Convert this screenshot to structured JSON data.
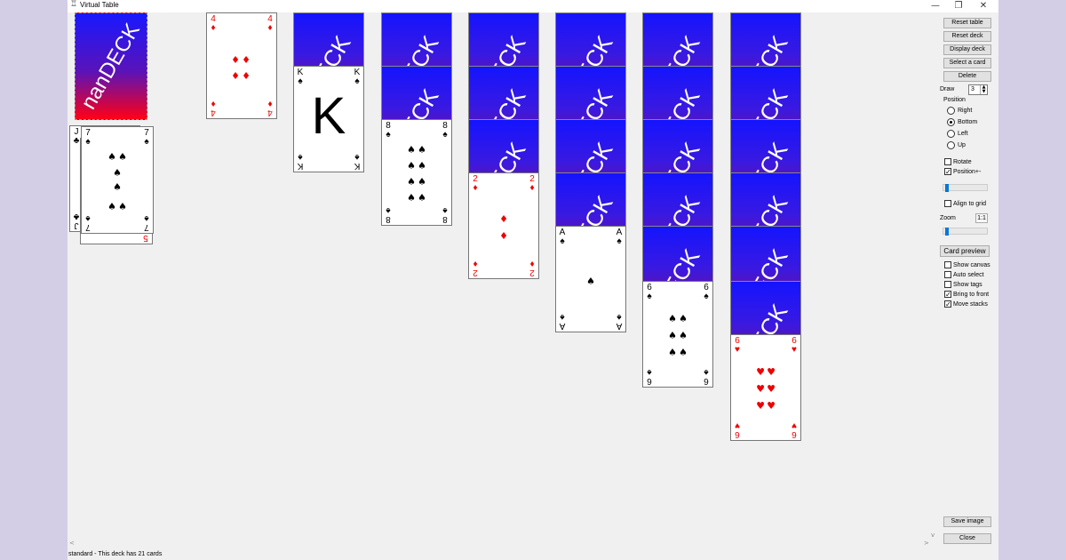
{
  "window": {
    "title": "Virtual Table",
    "minimize": "—",
    "restore": "❐",
    "close": "✕"
  },
  "deck_back_text": "nanDECK",
  "deck_back_short": "DECK",
  "cards": {
    "jack": {
      "rank": "J",
      "suit": "♣"
    },
    "seven": {
      "rank": "7",
      "suit": "♠"
    },
    "five": {
      "rank": "5",
      "suit": "♥"
    },
    "four": {
      "rank": "4",
      "suit": "♦"
    },
    "king": {
      "rank": "K",
      "suit": "♠",
      "face": "K"
    },
    "eight": {
      "rank": "8",
      "suit": "♠"
    },
    "two": {
      "rank": "2",
      "suit": "♦"
    },
    "ace": {
      "rank": "A",
      "suit": "♠"
    },
    "six_spades": {
      "rank": "6",
      "suit": "♠"
    },
    "six_hearts": {
      "rank": "6",
      "suit": "♥"
    }
  },
  "panel": {
    "reset_table": "Reset table",
    "reset_deck": "Reset deck",
    "display_deck": "Display deck",
    "select_card": "Select a card",
    "delete": "Delete",
    "draw_label": "Draw",
    "draw_value": "3",
    "position_label": "Position",
    "pos_right": "Right",
    "pos_bottom": "Bottom",
    "pos_left": "Left",
    "pos_up": "Up",
    "rotate": "Rotate",
    "position_pm": "Position+-",
    "align_grid": "Align to grid",
    "zoom_label": "Zoom",
    "zoom_value": "1:1",
    "card_preview": "Card preview",
    "show_canvas": "Show canvas",
    "auto_select": "Auto select",
    "show_tags": "Show tags",
    "bring_front": "Bring to front",
    "move_stacks": "Move stacks",
    "save_image": "Save image",
    "close": "Close"
  },
  "checkbox_state": {
    "rotate": false,
    "position_pm": true,
    "align_grid": false,
    "show_canvas": false,
    "auto_select": false,
    "show_tags": false,
    "bring_front": true,
    "move_stacks": true
  },
  "selected_position": "Bottom",
  "status": "standard - This deck has 21 cards",
  "colors": {
    "red_suit": "#ee0000",
    "black_suit": "#000000",
    "back_top": "#1818ff",
    "back_bottom": "#ff0016"
  }
}
